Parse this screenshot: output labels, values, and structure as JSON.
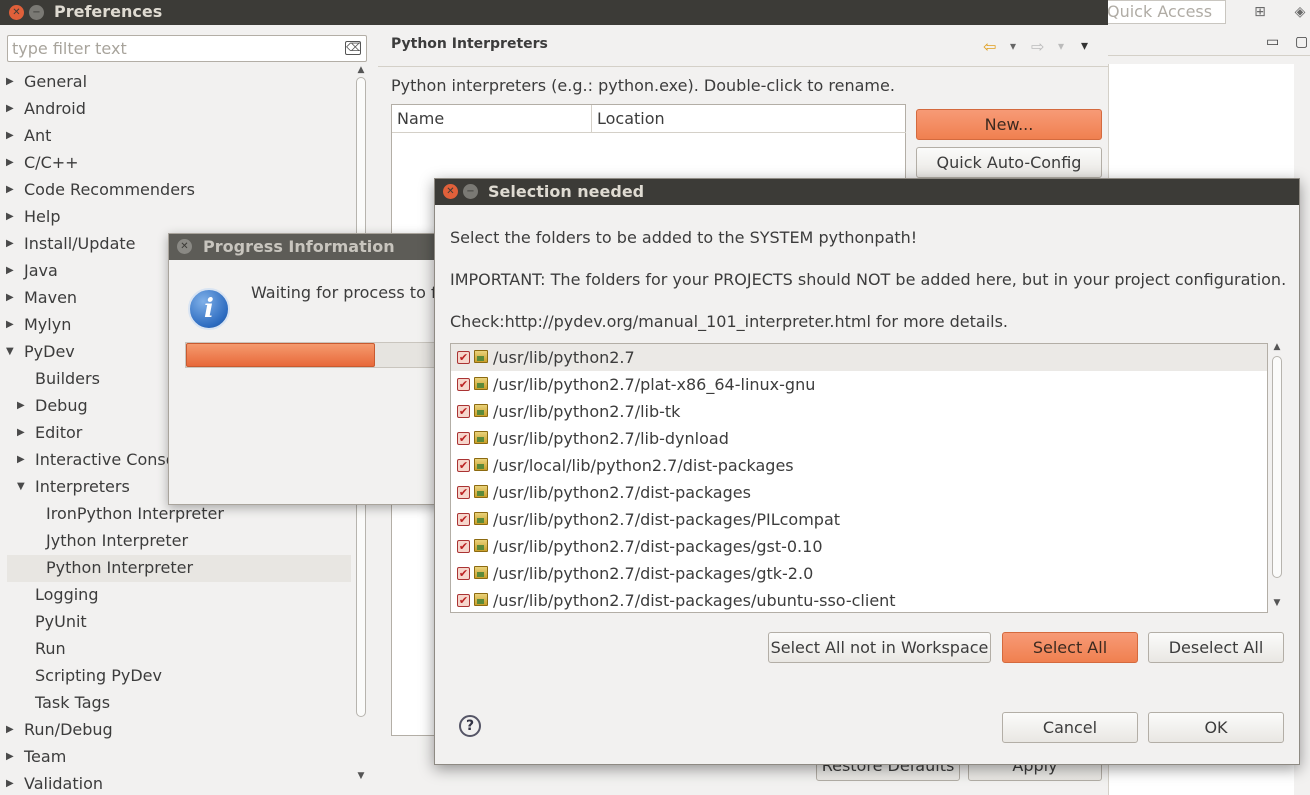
{
  "window": {
    "title": "Preferences",
    "quick_access_placeholder": "Quick Access"
  },
  "filter": {
    "placeholder": "type filter text"
  },
  "tree": [
    {
      "label": "General",
      "level": 0,
      "arrow": "▶"
    },
    {
      "label": "Android",
      "level": 0,
      "arrow": "▶"
    },
    {
      "label": "Ant",
      "level": 0,
      "arrow": "▶"
    },
    {
      "label": "C/C++",
      "level": 0,
      "arrow": "▶"
    },
    {
      "label": "Code Recommenders",
      "level": 0,
      "arrow": "▶"
    },
    {
      "label": "Help",
      "level": 0,
      "arrow": "▶"
    },
    {
      "label": "Install/Update",
      "level": 0,
      "arrow": "▶"
    },
    {
      "label": "Java",
      "level": 0,
      "arrow": "▶"
    },
    {
      "label": "Maven",
      "level": 0,
      "arrow": "▶"
    },
    {
      "label": "Mylyn",
      "level": 0,
      "arrow": "▶"
    },
    {
      "label": "PyDev",
      "level": 0,
      "arrow": "▼"
    },
    {
      "label": "Builders",
      "level": 1,
      "arrow": ""
    },
    {
      "label": "Debug",
      "level": 1,
      "arrow": "▶"
    },
    {
      "label": "Editor",
      "level": 1,
      "arrow": "▶"
    },
    {
      "label": "Interactive Console",
      "level": 1,
      "arrow": "▶"
    },
    {
      "label": "Interpreters",
      "level": 1,
      "arrow": "▼"
    },
    {
      "label": "IronPython Interpreter",
      "level": 2,
      "arrow": ""
    },
    {
      "label": "Jython Interpreter",
      "level": 2,
      "arrow": ""
    },
    {
      "label": "Python Interpreter",
      "level": 2,
      "arrow": "",
      "selected": true
    },
    {
      "label": "Logging",
      "level": 1,
      "arrow": ""
    },
    {
      "label": "PyUnit",
      "level": 1,
      "arrow": ""
    },
    {
      "label": "Run",
      "level": 1,
      "arrow": ""
    },
    {
      "label": "Scripting PyDev",
      "level": 1,
      "arrow": ""
    },
    {
      "label": "Task Tags",
      "level": 1,
      "arrow": ""
    },
    {
      "label": "Run/Debug",
      "level": 0,
      "arrow": "▶"
    },
    {
      "label": "Team",
      "level": 0,
      "arrow": "▶"
    },
    {
      "label": "Validation",
      "level": 0,
      "arrow": "▶"
    }
  ],
  "page": {
    "title": "Python Interpreters",
    "description": "Python interpreters (e.g.: python.exe).   Double-click to rename.",
    "columns": [
      "Name",
      "Location"
    ],
    "new_button": "New...",
    "auto_config_button": "Quick Auto-Config",
    "restore_defaults_button": "Restore Defaults",
    "apply_button": "Apply"
  },
  "progress_dialog": {
    "title": "Progress Information",
    "message": "Waiting for process to finish.",
    "progress_fraction": 0.63,
    "info_glyph": "i"
  },
  "selection_dialog": {
    "title": "Selection needed",
    "line1": "Select the folders to be added to the SYSTEM pythonpath!",
    "line2": "IMPORTANT: The folders for your PROJECTS should NOT be added here, but in your project configuration.",
    "line3": "Check:http://pydev.org/manual_101_interpreter.html for more details.",
    "folders": [
      {
        "path": "/usr/lib/python2.7",
        "checked": true,
        "selected": true
      },
      {
        "path": "/usr/lib/python2.7/plat-x86_64-linux-gnu",
        "checked": true
      },
      {
        "path": "/usr/lib/python2.7/lib-tk",
        "checked": true
      },
      {
        "path": "/usr/lib/python2.7/lib-dynload",
        "checked": true
      },
      {
        "path": "/usr/local/lib/python2.7/dist-packages",
        "checked": true
      },
      {
        "path": "/usr/lib/python2.7/dist-packages",
        "checked": true
      },
      {
        "path": "/usr/lib/python2.7/dist-packages/PILcompat",
        "checked": true
      },
      {
        "path": "/usr/lib/python2.7/dist-packages/gst-0.10",
        "checked": true
      },
      {
        "path": "/usr/lib/python2.7/dist-packages/gtk-2.0",
        "checked": true
      },
      {
        "path": "/usr/lib/python2.7/dist-packages/ubuntu-sso-client",
        "checked": true
      }
    ],
    "select_not_in_workspace_button": "Select All not in Workspace",
    "select_all_button": "Select All",
    "deselect_all_button": "Deselect All",
    "cancel_button": "Cancel",
    "ok_button": "OK",
    "help_glyph": "?"
  },
  "icons": {
    "close": "✕",
    "minimize": "−",
    "back_arrow": "⇦",
    "forward_arrow": "⇨",
    "dropdown": "▾",
    "menu": "▾",
    "check": "✔"
  },
  "colors": {
    "accent": "#f08050",
    "titlebar": "#3c3b37",
    "background": "#f2f1f0"
  }
}
